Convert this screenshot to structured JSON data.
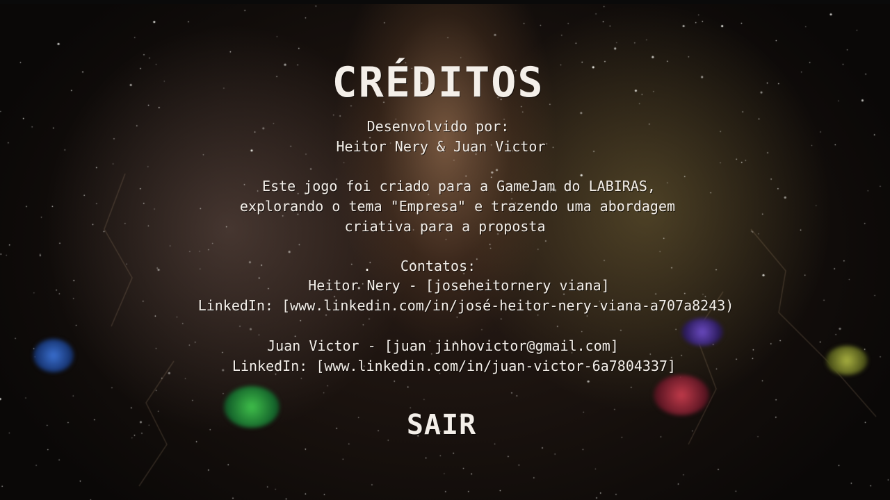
{
  "screen": {
    "title": "CRÉDITOS",
    "developed_by_label": "Desenvolvido por:",
    "developers": "Heitor Nery & Juan Victor",
    "description_lines": [
      "Este jogo foi criado para a GameJam do LABIRAS,",
      "explorando o tema \"Empresa\" e trazendo uma abordagem",
      "criativa para a proposta"
    ],
    "contacts_bullet": ".",
    "contacts_label": "Contatos:",
    "contacts": [
      {
        "email_line": "Heitor Nery - [joseheitornery viana]",
        "linkedin_line": "LinkedIn: [www.linkedin.com/in/josé-heitor-nery-viana-a707a8243)"
      },
      {
        "email_line": "Juan Victor - [juan jinhovictor@gmail.com]",
        "linkedin_line": "LinkedIn: [www.linkedin.com/in/juan-victor-6a7804337]"
      }
    ],
    "exit_label": "SAIR"
  },
  "colors": {
    "text": "#f4efe9",
    "background": "#0b0908"
  }
}
